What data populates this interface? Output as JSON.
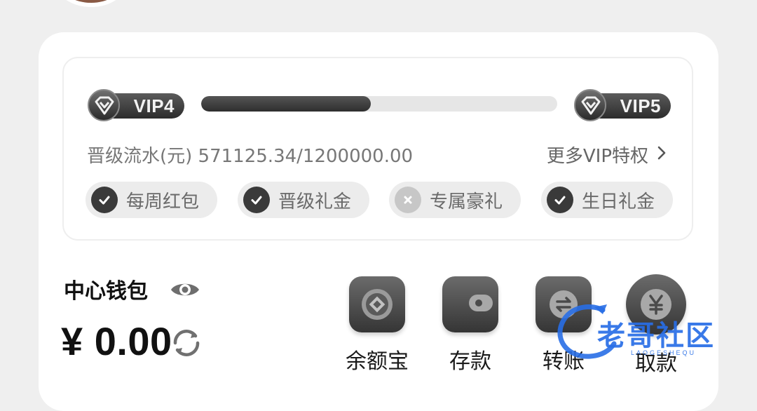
{
  "vip": {
    "current_level": "VIP4",
    "next_level": "VIP5",
    "progress_fraction": 0.4759,
    "turnover_label": "晋级流水(元) 571125.34/1200000.00",
    "more_privileges_label": "更多VIP特权",
    "benefits": [
      {
        "label": "每周红包",
        "status": "unlocked",
        "icon": "check-icon"
      },
      {
        "label": "晋级礼金",
        "status": "unlocked",
        "icon": "check-icon"
      },
      {
        "label": "专属豪礼",
        "status": "locked",
        "icon": "close-icon"
      },
      {
        "label": "生日礼金",
        "status": "unlocked",
        "icon": "check-icon"
      }
    ]
  },
  "wallet": {
    "title": "中心钱包",
    "balance": "¥ 0.00"
  },
  "actions": [
    {
      "label": "余额宝",
      "icon": "savings-icon"
    },
    {
      "label": "存款",
      "icon": "wallet-icon"
    },
    {
      "label": "转账",
      "icon": "transfer-icon"
    },
    {
      "label": "取款",
      "icon": "yen-icon"
    }
  ],
  "watermark": {
    "text": "老哥社区",
    "subtext": "LAOGESHEQU"
  },
  "colors": {
    "dark_accent": "#3a3a3a",
    "track": "#e6e6e6",
    "watermark_blue": "#286ee6"
  }
}
